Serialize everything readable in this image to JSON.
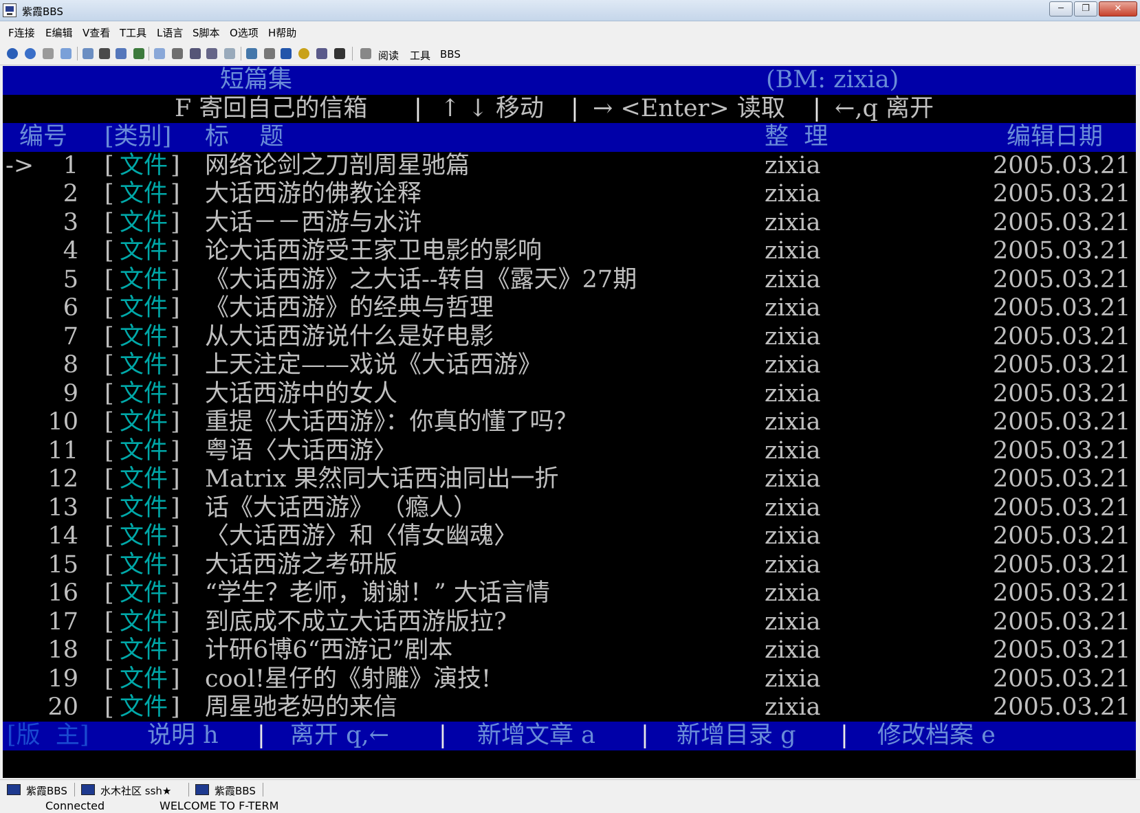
{
  "window": {
    "title": "紫霞BBS",
    "min_label": "─",
    "max_label": "❐",
    "close_label": "✕"
  },
  "menu": [
    "F连接",
    "E编辑",
    "V查看",
    "T工具",
    "L语言",
    "S脚本",
    "O选项",
    "H帮助"
  ],
  "toolbar": {
    "text_items": [
      "阅读",
      "工具",
      "BBS"
    ]
  },
  "terminal": {
    "header": {
      "board_title": "短篇集",
      "bm": "(BM: zixia)"
    },
    "help_line": {
      "mail": "F 寄回自己的信箱",
      "sep1": "|",
      "move": "↑ ↓ 移动",
      "sep2": "|",
      "read": "→ <Enter> 读取",
      "sep3": "|",
      "leave": "←,q 离开"
    },
    "columns": {
      "num": "编号",
      "category": "[类别]",
      "title": "标    题",
      "editor": "整  理",
      "date": "编辑日期"
    },
    "cursor": "->",
    "rows": [
      {
        "num": "1",
        "lb": "[",
        "cat": "文件",
        "rb": "]",
        "title": "网络论剑之刀剖周星驰篇",
        "editor": "zixia",
        "date": "2005.03.21"
      },
      {
        "num": "2",
        "lb": "[",
        "cat": "文件",
        "rb": "]",
        "title": "大话西游的佛教诠释",
        "editor": "zixia",
        "date": "2005.03.21"
      },
      {
        "num": "3",
        "lb": "[",
        "cat": "文件",
        "rb": "]",
        "title": "大话－－西游与水浒",
        "editor": "zixia",
        "date": "2005.03.21"
      },
      {
        "num": "4",
        "lb": "[",
        "cat": "文件",
        "rb": "]",
        "title": "论大话西游受王家卫电影的影响",
        "editor": "zixia",
        "date": "2005.03.21"
      },
      {
        "num": "5",
        "lb": "[",
        "cat": "文件",
        "rb": "]",
        "title": "《大话西游》之大话--转自《露天》27期",
        "editor": "zixia",
        "date": "2005.03.21"
      },
      {
        "num": "6",
        "lb": "[",
        "cat": "文件",
        "rb": "]",
        "title": "《大话西游》的经典与哲理",
        "editor": "zixia",
        "date": "2005.03.21"
      },
      {
        "num": "7",
        "lb": "[",
        "cat": "文件",
        "rb": "]",
        "title": "从大话西游说什么是好电影",
        "editor": "zixia",
        "date": "2005.03.21"
      },
      {
        "num": "8",
        "lb": "[",
        "cat": "文件",
        "rb": "]",
        "title": "上天注定——戏说《大话西游》",
        "editor": "zixia",
        "date": "2005.03.21"
      },
      {
        "num": "9",
        "lb": "[",
        "cat": "文件",
        "rb": "]",
        "title": "大话西游中的女人",
        "editor": "zixia",
        "date": "2005.03.21"
      },
      {
        "num": "10",
        "lb": "[",
        "cat": "文件",
        "rb": "]",
        "title": "重提《大话西游》：你真的懂了吗？",
        "editor": "zixia",
        "date": "2005.03.21"
      },
      {
        "num": "11",
        "lb": "[",
        "cat": "文件",
        "rb": "]",
        "title": "粤语〈大话西游〉",
        "editor": "zixia",
        "date": "2005.03.21"
      },
      {
        "num": "12",
        "lb": "[",
        "cat": "文件",
        "rb": "]",
        "title": "Matrix 果然同大话西油同出一折",
        "editor": "zixia",
        "date": "2005.03.21"
      },
      {
        "num": "13",
        "lb": "[",
        "cat": "文件",
        "rb": "]",
        "title": "话《大话西游》 （瘾人）",
        "editor": "zixia",
        "date": "2005.03.21"
      },
      {
        "num": "14",
        "lb": "[",
        "cat": "文件",
        "rb": "]",
        "title": "〈大话西游〉和〈倩女幽魂〉",
        "editor": "zixia",
        "date": "2005.03.21"
      },
      {
        "num": "15",
        "lb": "[",
        "cat": "文件",
        "rb": "]",
        "title": "大话西游之考研版",
        "editor": "zixia",
        "date": "2005.03.21"
      },
      {
        "num": "16",
        "lb": "[",
        "cat": "文件",
        "rb": "]",
        "title": "“学生？老师，谢谢！” 大话言情",
        "editor": "zixia",
        "date": "2005.03.21"
      },
      {
        "num": "17",
        "lb": "[",
        "cat": "文件",
        "rb": "]",
        "title": "到底成不成立大话西游版拉?",
        "editor": "zixia",
        "date": "2005.03.21"
      },
      {
        "num": "18",
        "lb": "[",
        "cat": "文件",
        "rb": "]",
        "title": "计研6博6“西游记”剧本",
        "editor": "zixia",
        "date": "2005.03.21"
      },
      {
        "num": "19",
        "lb": "[",
        "cat": "文件",
        "rb": "]",
        "title": "cool!星仔的《射雕》演技!",
        "editor": "zixia",
        "date": "2005.03.21"
      },
      {
        "num": "20",
        "lb": "[",
        "cat": "文件",
        "rb": "]",
        "title": "周星驰老妈的来信",
        "editor": "zixia",
        "date": "2005.03.21"
      }
    ],
    "footer": {
      "mode": "[版  主]",
      "help": "说明 h",
      "sep1": "|",
      "leave": "离开 q,←",
      "sep2": "|",
      "add_article": "新增文章 a",
      "sep3": "|",
      "add_dir": "新增目录 g",
      "sep4": "|",
      "edit_file": "修改档案 e"
    }
  },
  "statusbar": {
    "tasks": [
      "紫霞BBS",
      "水木社区 ssh★",
      "紫霞BBS"
    ],
    "connection": "Connected",
    "welcome": "WELCOME TO F-TERM"
  },
  "colors": {
    "terminal_bg": "#000000",
    "highlight_bar": "#0000a8",
    "category_text": "#00a8a8",
    "text": "#c0c0c0"
  }
}
